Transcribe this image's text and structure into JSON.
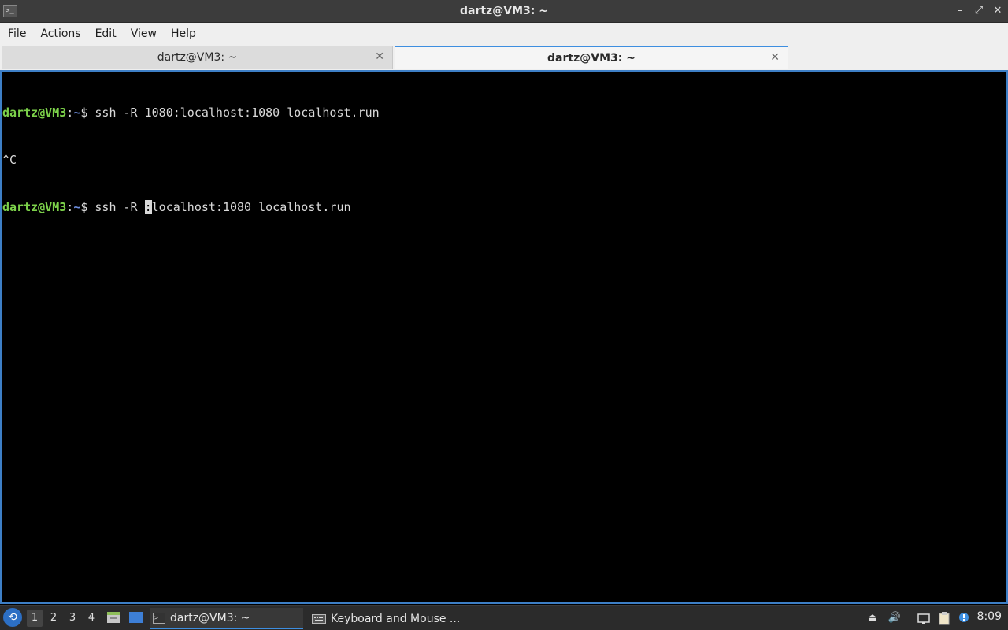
{
  "window": {
    "title": "dartz@VM3: ~",
    "icon": "terminal-icon",
    "buttons": [
      "–",
      "⤢",
      "✕"
    ]
  },
  "menubar": {
    "items": [
      "File",
      "Actions",
      "Edit",
      "View",
      "Help"
    ]
  },
  "tabs": [
    {
      "label": "dartz@VM3: ~",
      "active": false
    },
    {
      "label": "dartz@VM3: ~",
      "active": true
    }
  ],
  "terminal": {
    "lines": [
      {
        "user": "dartz@VM3",
        "sep": ":",
        "path": "~",
        "prompt": "$ ",
        "cmd_before": "ssh -R 1080:localhost:1080 localhost.run",
        "cursor": "",
        "cmd_after": ""
      },
      {
        "text": "^C"
      },
      {
        "user": "dartz@VM3",
        "sep": ":",
        "path": "~",
        "prompt": "$ ",
        "cmd_before": "ssh -R ",
        "cursor": ":",
        "cmd_after": "localhost:1080 localhost.run"
      }
    ],
    "colors": {
      "user": "#7cd14a",
      "path": "#6e8fe0",
      "text": "#d9d9d9",
      "border": "#3d7fc6"
    }
  },
  "taskbar": {
    "start_icon": "lxqt-start-icon",
    "workspaces": [
      "1",
      "2",
      "3",
      "4"
    ],
    "active_workspace": "1",
    "quicklaunch": [
      "file-manager-icon",
      "show-desktop-icon"
    ],
    "tasks": [
      {
        "label": "dartz@VM3: ~",
        "icon": "terminal-icon",
        "active": true
      },
      {
        "label": "Keyboard and Mouse ...",
        "icon": "keyboard-icon",
        "active": false
      }
    ],
    "tray": [
      "eject-icon",
      "volume-icon",
      "network-icon",
      "clipboard-icon",
      "update-notifier-icon"
    ],
    "clock": "8:09"
  }
}
